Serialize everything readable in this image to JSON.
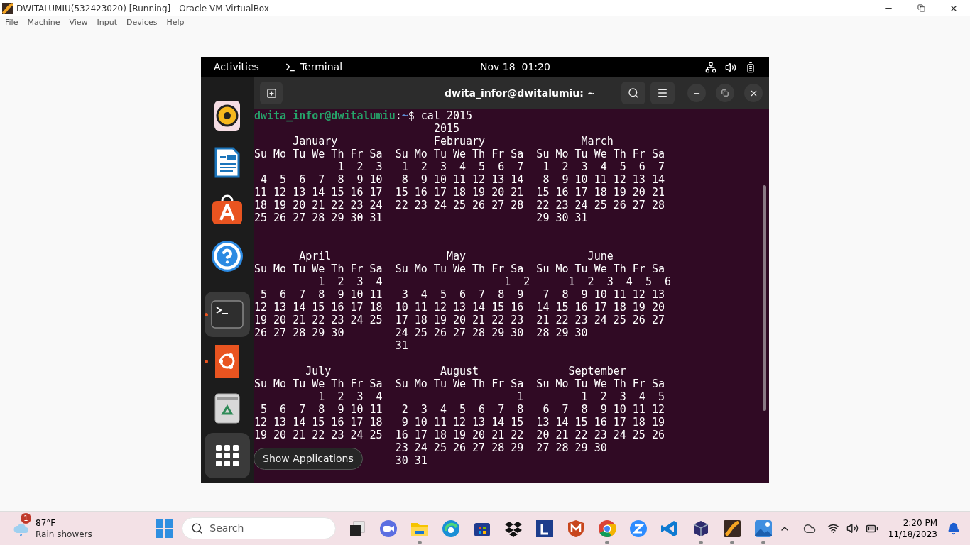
{
  "window": {
    "title": "DWITALUMIU(532423020) [Running] - Oracle VM VirtualBox"
  },
  "menu": [
    "File",
    "Machine",
    "View",
    "Input",
    "Devices",
    "Help"
  ],
  "vm": {
    "top_bar": {
      "activities": "Activities",
      "app": "Terminal",
      "clock": "Nov 18  01:20"
    },
    "dock": {
      "apps": [
        {
          "kind": "music",
          "running": false,
          "selected": false
        },
        {
          "kind": "writer",
          "running": false,
          "selected": false
        },
        {
          "kind": "store",
          "running": false,
          "selected": false
        },
        {
          "kind": "help",
          "running": false,
          "selected": false
        },
        {
          "kind": "terminal",
          "running": true,
          "selected": true
        },
        {
          "kind": "ubuntu",
          "running": true,
          "selected": false
        },
        {
          "kind": "trash",
          "running": false,
          "selected": false
        }
      ],
      "show_apps": {
        "tooltip": "Show Applications",
        "hovered": true
      }
    },
    "terminal": {
      "title": "dwita_infor@dwitalumiu: ~",
      "prompt": {
        "user_host": "dwita_infor@dwitalumiu",
        "separator": ":",
        "path": "~",
        "symbol": "$",
        "command": " cal 2015"
      },
      "year_line": "                            2015",
      "quarters": [
        {
          "lines": [
            "      January               February               March",
            "Su Mo Tu We Th Fr Sa  Su Mo Tu We Th Fr Sa  Su Mo Tu We Th Fr Sa",
            "             1  2  3   1  2  3  4  5  6  7   1  2  3  4  5  6  7",
            " 4  5  6  7  8  9 10   8  9 10 11 12 13 14   8  9 10 11 12 13 14",
            "11 12 13 14 15 16 17  15 16 17 18 19 20 21  15 16 17 18 19 20 21",
            "18 19 20 21 22 23 24  22 23 24 25 26 27 28  22 23 24 25 26 27 28",
            "25 26 27 28 29 30 31                        29 30 31"
          ]
        },
        {
          "lines": [
            "       April                  May                   June",
            "Su Mo Tu We Th Fr Sa  Su Mo Tu We Th Fr Sa  Su Mo Tu We Th Fr Sa",
            "          1  2  3  4                   1  2      1  2  3  4  5  6",
            " 5  6  7  8  9 10 11   3  4  5  6  7  8  9   7  8  9 10 11 12 13",
            "12 13 14 15 16 17 18  10 11 12 13 14 15 16  14 15 16 17 18 19 20",
            "19 20 21 22 23 24 25  17 18 19 20 21 22 23  21 22 23 24 25 26 27",
            "26 27 28 29 30        24 25 26 27 28 29 30  28 29 30",
            "                      31"
          ]
        },
        {
          "lines": [
            "        July                 August              September",
            "Su Mo Tu We Th Fr Sa  Su Mo Tu We Th Fr Sa  Su Mo Tu We Th Fr Sa",
            "          1  2  3  4                     1         1  2  3  4  5",
            " 5  6  7  8  9 10 11   2  3  4  5  6  7  8   6  7  8  9 10 11 12",
            "12 13 14 15 16 17 18   9 10 11 12 13 14 15  13 14 15 16 17 18 19",
            "19 20 21 22 23 24 25  16 17 18 19 20 21 22  20 21 22 23 24 25 26",
            "                      23 24 25 26 27 28 29  27 28 29 30",
            "                      30 31"
          ]
        }
      ]
    }
  },
  "taskbar": {
    "weather": {
      "badge": "1",
      "temperature": "87°F",
      "condition": "Rain showers"
    },
    "search": {
      "placeholder": "Search"
    },
    "apps": [
      {
        "kind": "task-view",
        "running": false
      },
      {
        "kind": "meet",
        "running": false
      },
      {
        "kind": "folder",
        "running": true
      },
      {
        "kind": "edge",
        "running": false
      },
      {
        "kind": "store",
        "running": false
      },
      {
        "kind": "dropbox",
        "running": false
      },
      {
        "kind": "lbox",
        "running": false
      },
      {
        "kind": "shield",
        "running": false
      },
      {
        "kind": "chrome",
        "running": true
      },
      {
        "kind": "zoom",
        "running": false
      },
      {
        "kind": "vscode",
        "running": false
      },
      {
        "kind": "vbox",
        "running": true
      },
      {
        "kind": "c4",
        "running": true
      },
      {
        "kind": "photos",
        "running": true
      }
    ],
    "time": "2:20 PM",
    "date": "11/18/2023"
  }
}
